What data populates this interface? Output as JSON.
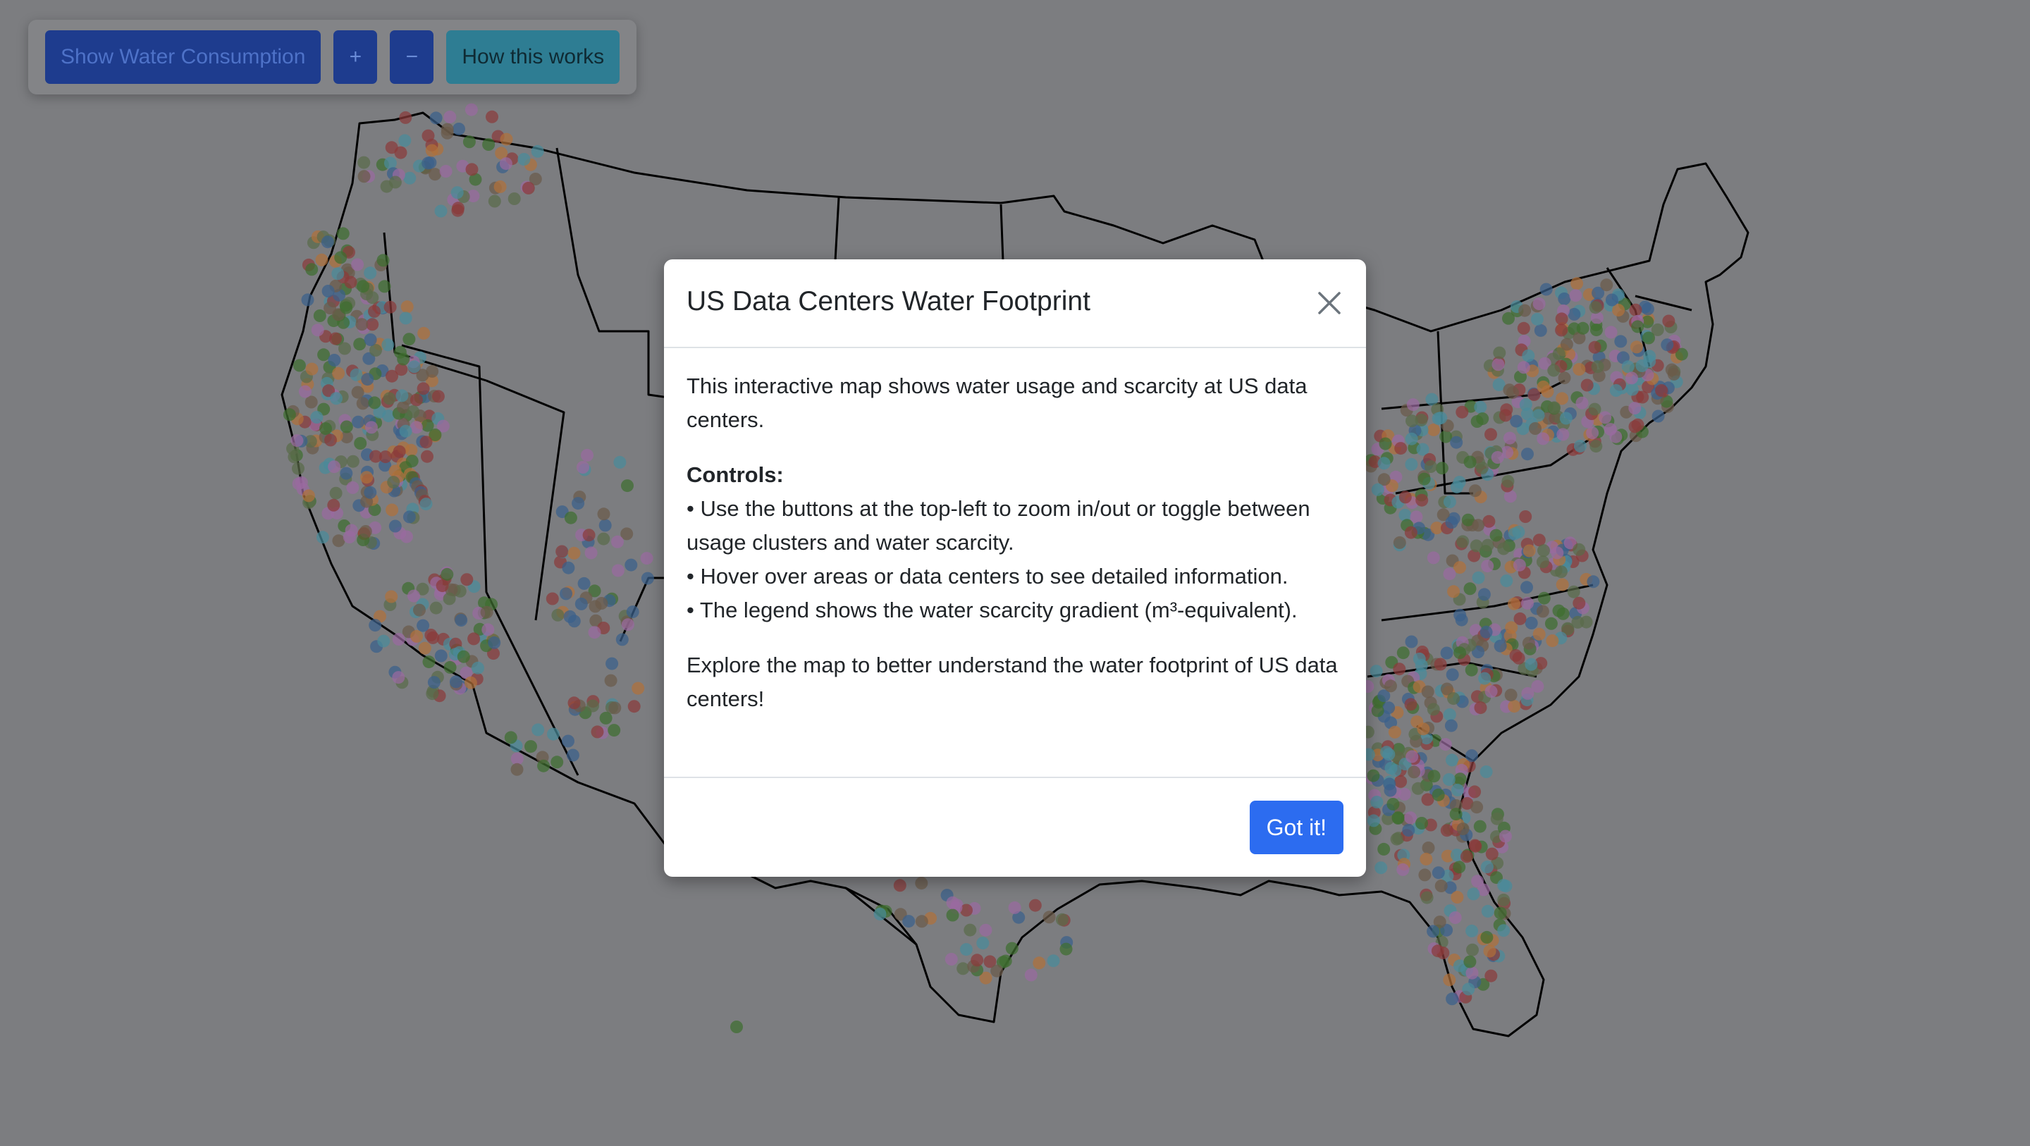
{
  "toolbar": {
    "toggle_label": "Show Water Consumption",
    "zoom_in_label": "+",
    "zoom_out_label": "−",
    "help_label": "How this works"
  },
  "modal": {
    "title": "US Data Centers Water Footprint",
    "intro": "This interactive map shows water usage and scarcity at US data centers.",
    "controls_title": "Controls:",
    "controls": [
      "• Use the buttons at the top-left to zoom in/out or toggle between usage clusters and water scarcity.",
      "• Hover over areas or data centers to see detailed information.",
      "• The legend shows the water scarcity gradient (m³-equivalent)."
    ],
    "outro": "Explore the map to better understand the water footprint of US data centers!",
    "got_it_label": "Got it!"
  },
  "colors": {
    "background": "#7c7d80",
    "dot_palette": [
      "#3f6e2f",
      "#8b3a3a",
      "#3a5f8a",
      "#b0703a",
      "#9a6aa0",
      "#5a6b4a",
      "#4a8a9a",
      "#6b5a4a"
    ],
    "primary": "#2c6cf0"
  }
}
